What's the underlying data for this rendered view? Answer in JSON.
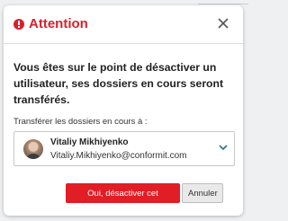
{
  "dialog": {
    "title": "Attention",
    "title_icon": "alert-circle-icon",
    "close_icon": "close-icon",
    "message": "Vous êtes sur le point de désactiver un utilisateur, ses dossiers en cours seront transférés.",
    "transfer_label": "Transférer les dossiers en cours à :",
    "selected_user": {
      "name": "Vitaliy Mikhiyenko",
      "email": "Vitaliy.Mikhiyenko@conformit.com"
    },
    "buttons": {
      "confirm_label": "Oui, désactiver cet utilisateur",
      "cancel_label": "Annuler"
    }
  },
  "colors": {
    "accent_red": "#e11d25",
    "title_red": "#d9202a",
    "chevron_teal": "#2a7d8c"
  }
}
